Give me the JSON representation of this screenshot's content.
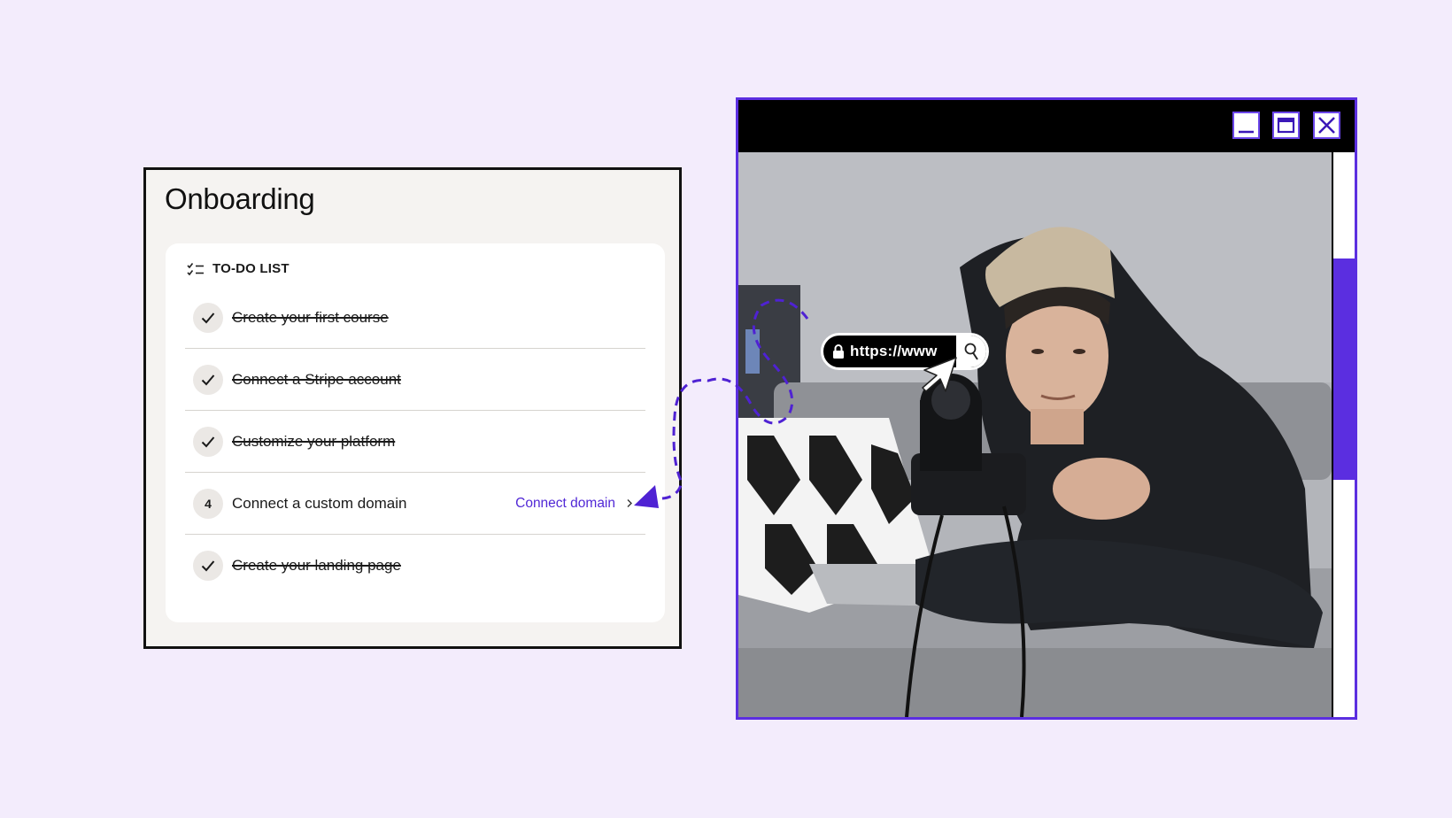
{
  "onboarding": {
    "title": "Onboarding",
    "todo": {
      "header": "TO-DO LIST",
      "header_icon": "checklist-icon",
      "tasks": [
        {
          "label": "Create your first course",
          "done": true,
          "badge": ""
        },
        {
          "label": "Connect a Stripe account",
          "done": true,
          "badge": ""
        },
        {
          "label": "Customize your platform",
          "done": true,
          "badge": ""
        },
        {
          "label": "Connect a custom domain",
          "done": false,
          "badge": "4",
          "action": "Connect domain"
        },
        {
          "label": "Create your landing page",
          "done": true,
          "badge": ""
        }
      ]
    }
  },
  "browser": {
    "window_controls": [
      "minimize-icon",
      "maximize-icon",
      "close-icon"
    ],
    "url": {
      "text": "https://www",
      "icon_left": "lock-icon",
      "icon_right": "search-icon"
    },
    "image_subject": "Man in cap and hoodie adjusting a camera on a sofa"
  },
  "colors": {
    "background": "#f3ecfc",
    "accent": "#5b2ee0",
    "link": "#5128d6",
    "card": "#f5f3f1"
  }
}
